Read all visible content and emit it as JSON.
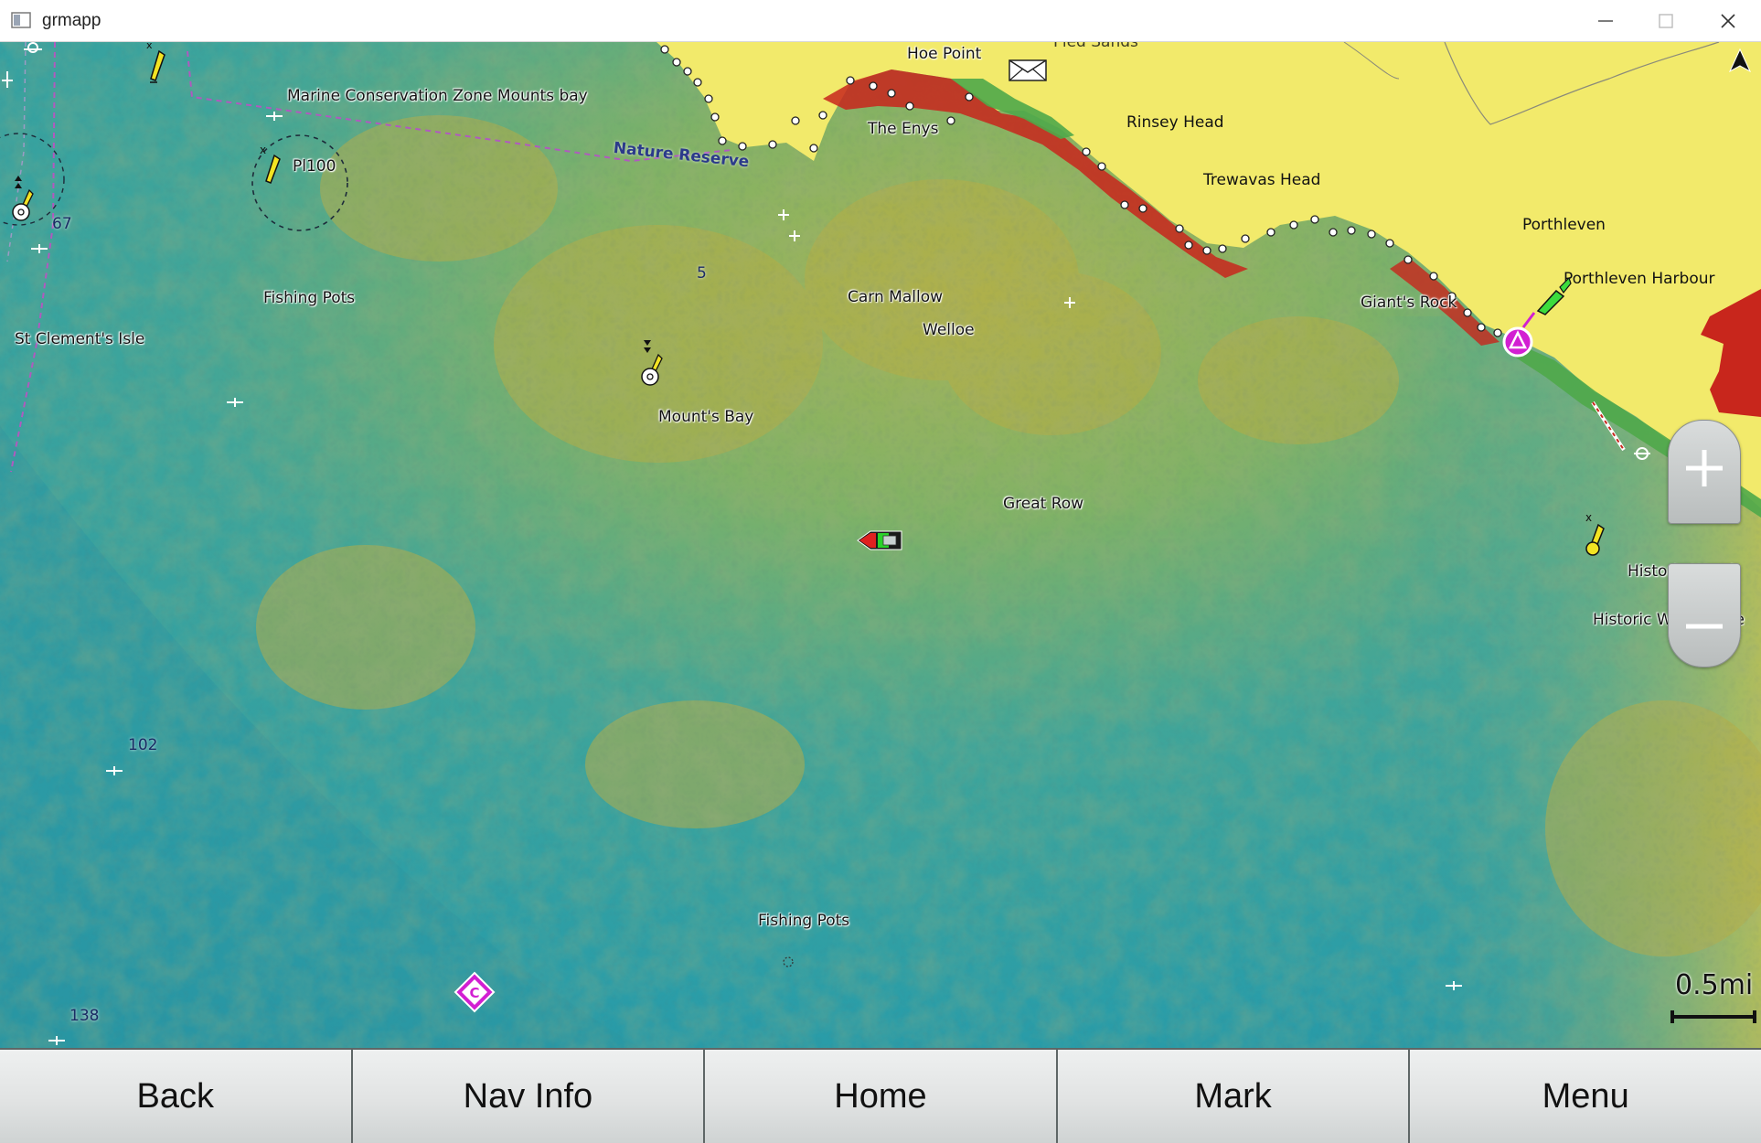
{
  "window": {
    "title": "grmapp",
    "buttons": [
      "minimize",
      "maximize",
      "close"
    ]
  },
  "map": {
    "labels": {
      "hoe_point": "Hoe Point",
      "pied_sands": "Pied Sands",
      "marine_zone": "Marine Conservation Zone Mounts bay",
      "nature_reserve": "Nature Reserve",
      "the_enys": "The Enys",
      "rinsey_head": "Rinsey Head",
      "trewavas_head": "Trewavas Head",
      "porthleven": "Porthleven",
      "porthleven_harbour": "Porthleven Harbour",
      "giants_rock": "Giant's Rock",
      "pl100": "Pl100",
      "fishing_pots_1": "Fishing Pots",
      "st_clements_isle": "St Clement's Isle",
      "carn_mallow": "Carn Mallow",
      "welloe": "Welloe",
      "mounts_bay": "Mount's Bay",
      "great_row": "Great Row",
      "historic_wreck_1": "Historic Wreck",
      "historic_wreck_2": "Historic Wreck (See",
      "fishing_pots_2": "Fishing Pots"
    },
    "depths": {
      "d67": "67",
      "d5": "5",
      "d102": "102",
      "d138": "138"
    },
    "scale": "0.5mi",
    "colors": {
      "land": "#f2ea6b",
      "deep_water": "#2aa0aa",
      "shallow_relief": "#c9b44a",
      "coast_red": "#c0201a",
      "coast_green": "#4fa84a",
      "waypoint_magenta": "#d21fd2"
    }
  },
  "toolbar": {
    "back": "Back",
    "nav_info": "Nav Info",
    "home": "Home",
    "mark": "Mark",
    "menu": "Menu"
  }
}
